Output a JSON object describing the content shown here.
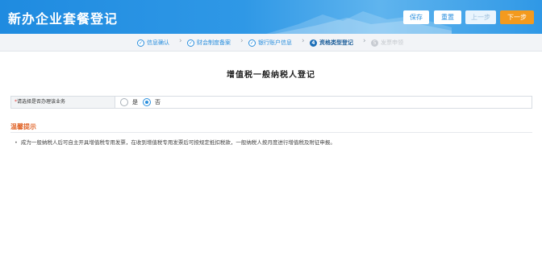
{
  "header": {
    "title": "新办企业套餐登记",
    "buttons": {
      "save": "保存",
      "reset": "重置",
      "prev": "上一步",
      "next": "下一步"
    }
  },
  "steps": [
    {
      "icon": "✓",
      "label": "信息确认",
      "state": "done"
    },
    {
      "icon": "✓",
      "label": "财会制度备案",
      "state": "done"
    },
    {
      "icon": "✓",
      "label": "银行账户信息",
      "state": "done"
    },
    {
      "icon": "4",
      "label": "资格类型登记",
      "state": "active"
    },
    {
      "icon": "5",
      "label": "发票申领",
      "state": "todo"
    }
  ],
  "form": {
    "title": "增值税一般纳税人登记",
    "field": {
      "required_mark": "*",
      "label": "请选择是否办理该业务",
      "options": [
        {
          "label": "是",
          "checked": false
        },
        {
          "label": "否",
          "checked": true
        }
      ]
    }
  },
  "tips": {
    "title": "温馨提示",
    "bullet": "•",
    "text": "成为一般纳税人后可自主开具增值税专用发票，在收到增值税专用发票后可按规定抵扣税款，一般纳税人按月度进行增值税及附征申报。"
  },
  "colors": {
    "header_blue": "#2a8fde",
    "next_orange": "#f39a1e",
    "tip_orange": "#e0652a",
    "required_red": "#e03a3a"
  }
}
